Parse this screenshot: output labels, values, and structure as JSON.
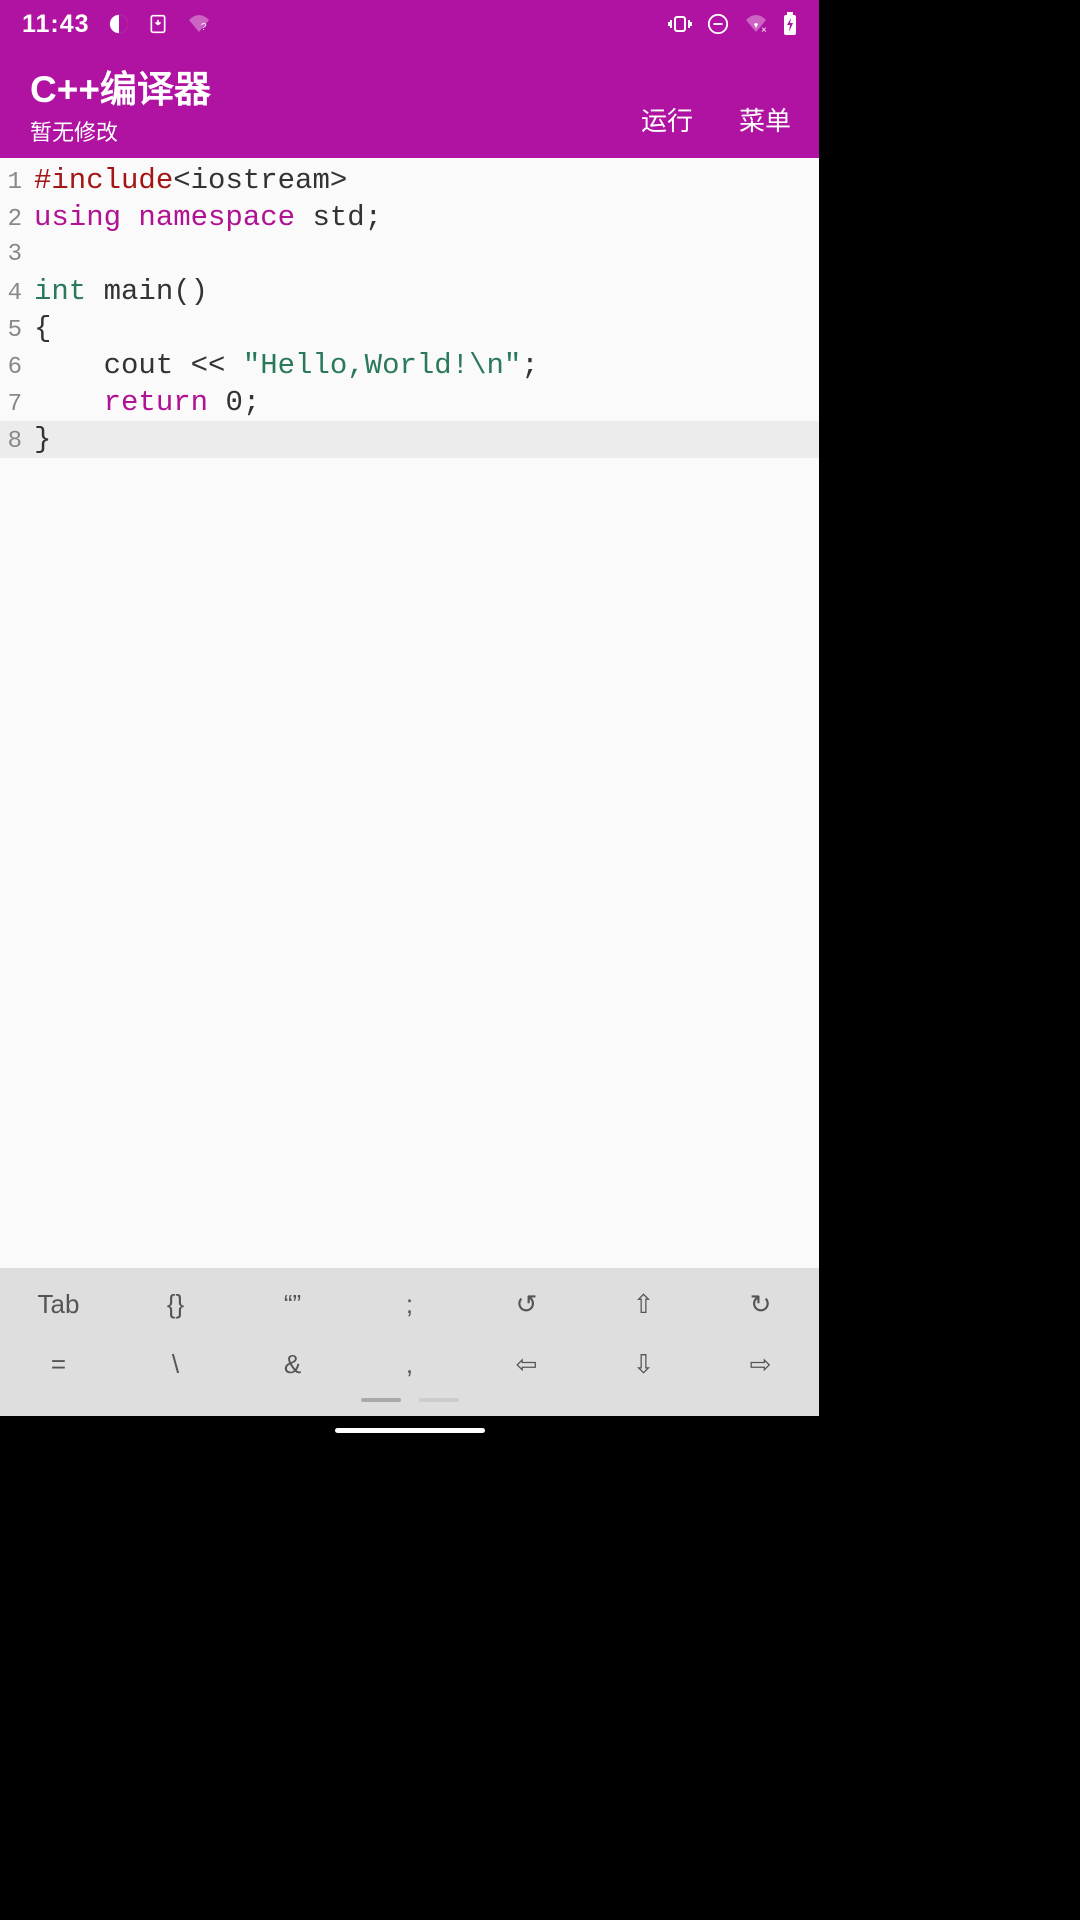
{
  "status": {
    "time": "11:43",
    "icons_left": [
      "contrast-icon",
      "download-icon",
      "wifi-question-icon"
    ],
    "icons_right": [
      "vibrate-icon",
      "dnd-icon",
      "wifi-off-icon",
      "battery-charging-icon"
    ]
  },
  "header": {
    "title": "C++编译器",
    "subtitle": "暂无修改",
    "run_label": "运行",
    "menu_label": "菜单"
  },
  "code": {
    "current_line": 8,
    "lines": [
      {
        "n": 1,
        "tokens": [
          {
            "c": "tok-preproc",
            "t": "#include"
          },
          {
            "c": "tok-angle",
            "t": "<iostream>"
          }
        ]
      },
      {
        "n": 2,
        "tokens": [
          {
            "c": "tok-keyword",
            "t": "using"
          },
          {
            "c": "tok-plain",
            "t": " "
          },
          {
            "c": "tok-keyword",
            "t": "namespace"
          },
          {
            "c": "tok-plain",
            "t": " std;"
          }
        ]
      },
      {
        "n": 3,
        "tokens": []
      },
      {
        "n": 4,
        "tokens": [
          {
            "c": "tok-type",
            "t": "int"
          },
          {
            "c": "tok-plain",
            "t": " main()"
          }
        ]
      },
      {
        "n": 5,
        "tokens": [
          {
            "c": "tok-plain",
            "t": "{"
          }
        ]
      },
      {
        "n": 6,
        "tokens": [
          {
            "c": "tok-plain",
            "t": "    cout << "
          },
          {
            "c": "tok-string",
            "t": "\"Hello,World!\\n\""
          },
          {
            "c": "tok-plain",
            "t": ";"
          }
        ]
      },
      {
        "n": 7,
        "tokens": [
          {
            "c": "tok-plain",
            "t": "    "
          },
          {
            "c": "tok-keyword",
            "t": "return"
          },
          {
            "c": "tok-plain",
            "t": " "
          },
          {
            "c": "tok-number",
            "t": "0"
          },
          {
            "c": "tok-plain",
            "t": ";"
          }
        ]
      },
      {
        "n": 8,
        "tokens": [
          {
            "c": "tok-plain",
            "t": "}"
          }
        ]
      }
    ]
  },
  "symbols": {
    "row1": [
      "Tab",
      "{}",
      "“”",
      ";",
      "↺",
      "⇧",
      "↻"
    ],
    "row2": [
      "=",
      "\\",
      "&",
      ",",
      "⇦",
      "⇩",
      "⇨"
    ]
  }
}
